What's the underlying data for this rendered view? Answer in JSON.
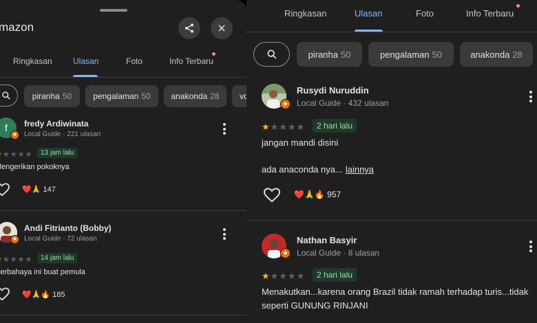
{
  "left": {
    "app_title": "mazon",
    "tabs": [
      {
        "label": "Ringkasan",
        "active": false
      },
      {
        "label": "Ulasan",
        "active": true
      },
      {
        "label": "Foto",
        "active": false
      },
      {
        "label": "Info Terbaru",
        "active": false,
        "notification": true
      }
    ],
    "chips": [
      {
        "label": "piranha",
        "count": "50"
      },
      {
        "label": "pengalaman",
        "count": "50"
      },
      {
        "label": "anakonda",
        "count": "28"
      },
      {
        "label": "vo",
        "count": ""
      }
    ],
    "reviews": [
      {
        "name": "fredy Ardiwinata",
        "avatar_letter": "f",
        "meta": "Local Guide · 221 ulasan",
        "rating": 1,
        "time": "13 jam lalu",
        "text": "Mengerikan pokoknya",
        "reactions": "❤️🙏",
        "reaction_count": "147"
      },
      {
        "name": "Andi Fitrianto (Bobby)",
        "meta": "Local Guide · 72 ulasan",
        "rating": 1,
        "time": "14 jam lalu",
        "text": "Berbahaya ini buat pemula",
        "reactions": "❤️🙏🔥",
        "reaction_count": "185"
      }
    ]
  },
  "right": {
    "tabs": [
      {
        "label": "Ringkasan",
        "active": false
      },
      {
        "label": "Ulasan",
        "active": true
      },
      {
        "label": "Foto",
        "active": false
      },
      {
        "label": "Info Terbaru",
        "active": false,
        "notification": true
      }
    ],
    "chips": [
      {
        "label": "piranha",
        "count": "50"
      },
      {
        "label": "pengalaman",
        "count": "50"
      },
      {
        "label": "anakonda",
        "count": "28"
      }
    ],
    "reviews": [
      {
        "name": "Rusydi Nuruddin",
        "meta": "Local Guide · 432 ulasan",
        "rating": 1,
        "time": "2 hari lalu",
        "text_line1": "jangan mandi disini",
        "text_line2": "ada anaconda nya...",
        "more": "lainnya",
        "reactions": "❤️🙏🔥",
        "reaction_count": "957"
      },
      {
        "name": "Nathan Basyir",
        "meta": "Local Guide · 8 ulasan",
        "rating": 1,
        "time": "2 hari lalu",
        "text_line1": "Menakutkan...karena orang Brazil tidak ramah terhadap turis...tidak",
        "text_line2": "seperti GUNUNG RINJANI"
      }
    ]
  },
  "colors": {
    "accent": "#8ab4f8",
    "star": "#fbbc04",
    "local_guide_badge": "#e8710a",
    "time_tag_bg": "#1e3a28"
  },
  "icons": [
    "share-icon",
    "close-icon",
    "search-icon",
    "more-vert-icon",
    "heart-outline-icon",
    "star-icon"
  ]
}
